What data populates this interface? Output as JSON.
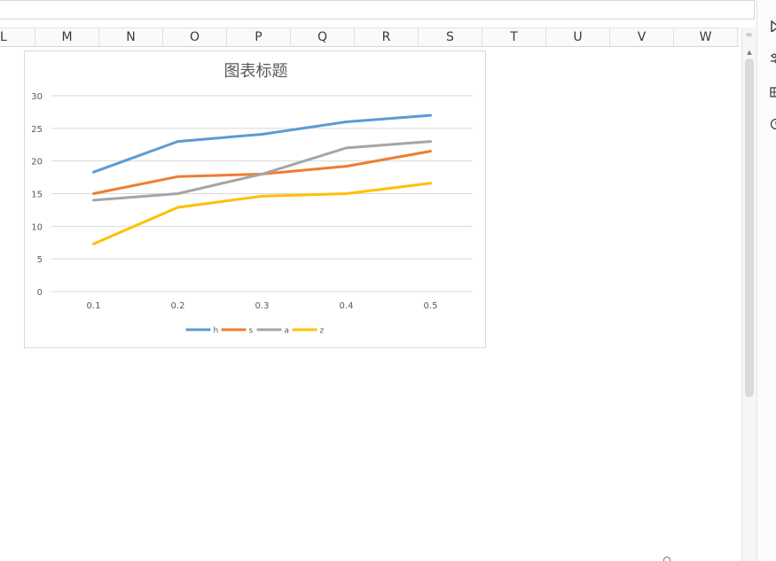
{
  "spreadsheet": {
    "columns": [
      "L",
      "M",
      "N",
      "O",
      "P",
      "Q",
      "R",
      "S",
      "T",
      "U",
      "V",
      "W"
    ],
    "scroll_corner_symbol": "=",
    "scroll_up_symbol": "▲"
  },
  "colors": {
    "series": [
      "#5b9bd5",
      "#ed7d31",
      "#a5a5a5",
      "#ffc000"
    ],
    "gridline": "#d9d9d9",
    "tick_text": "#595959"
  },
  "chart_data": {
    "type": "line",
    "title": "图表标题",
    "xlabel": "",
    "ylabel": "",
    "x": [
      0.1,
      0.2,
      0.3,
      0.4,
      0.5
    ],
    "x_tick_labels": [
      "0.1",
      "0.2",
      "0.3",
      "0.4",
      "0.5"
    ],
    "y_ticks": [
      0,
      5,
      10,
      15,
      20,
      25,
      30
    ],
    "ylim": [
      0,
      30
    ],
    "grid": true,
    "legend_position": "bottom",
    "series": [
      {
        "name": "h",
        "values": [
          18.3,
          23.0,
          24.1,
          26.0,
          27.0
        ]
      },
      {
        "name": "s",
        "values": [
          15.0,
          17.6,
          18.0,
          19.2,
          21.5
        ]
      },
      {
        "name": "a",
        "values": [
          14.0,
          15.0,
          18.0,
          22.0,
          23.0
        ]
      },
      {
        "name": "z",
        "values": [
          7.3,
          12.9,
          14.6,
          15.0,
          16.6
        ]
      }
    ]
  }
}
